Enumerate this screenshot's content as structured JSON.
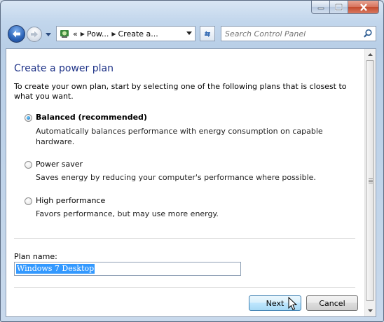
{
  "window": {
    "controls": [
      "minimize",
      "maximize",
      "close"
    ],
    "close_color": "#c44a2e"
  },
  "navbar": {
    "back_icon": "back-arrow-icon",
    "forward_icon": "forward-arrow-icon",
    "breadcrumb_prefix": "«",
    "breadcrumbs": [
      "Pow...",
      "Create a..."
    ],
    "refresh_icon": "refresh-icon",
    "search_placeholder": "Search Control Panel"
  },
  "page": {
    "title": "Create a power plan",
    "intro": "To create your own plan, start by selecting one of the following plans that is closest to what you want.",
    "options": [
      {
        "label": "Balanced (recommended)",
        "description": "Automatically balances performance with energy consumption on capable hardware.",
        "selected": true
      },
      {
        "label": "Power saver",
        "description": "Saves energy by reducing your computer's performance where possible.",
        "selected": false
      },
      {
        "label": "High performance",
        "description": "Favors performance, but may use more energy.",
        "selected": false
      }
    ],
    "plan_name_label": "Plan name:",
    "plan_name_value": "Windows 7 Desktop"
  },
  "buttons": {
    "next": "Next",
    "cancel": "Cancel"
  },
  "colors": {
    "heading": "#1e3287",
    "selection": "#3399ff"
  }
}
